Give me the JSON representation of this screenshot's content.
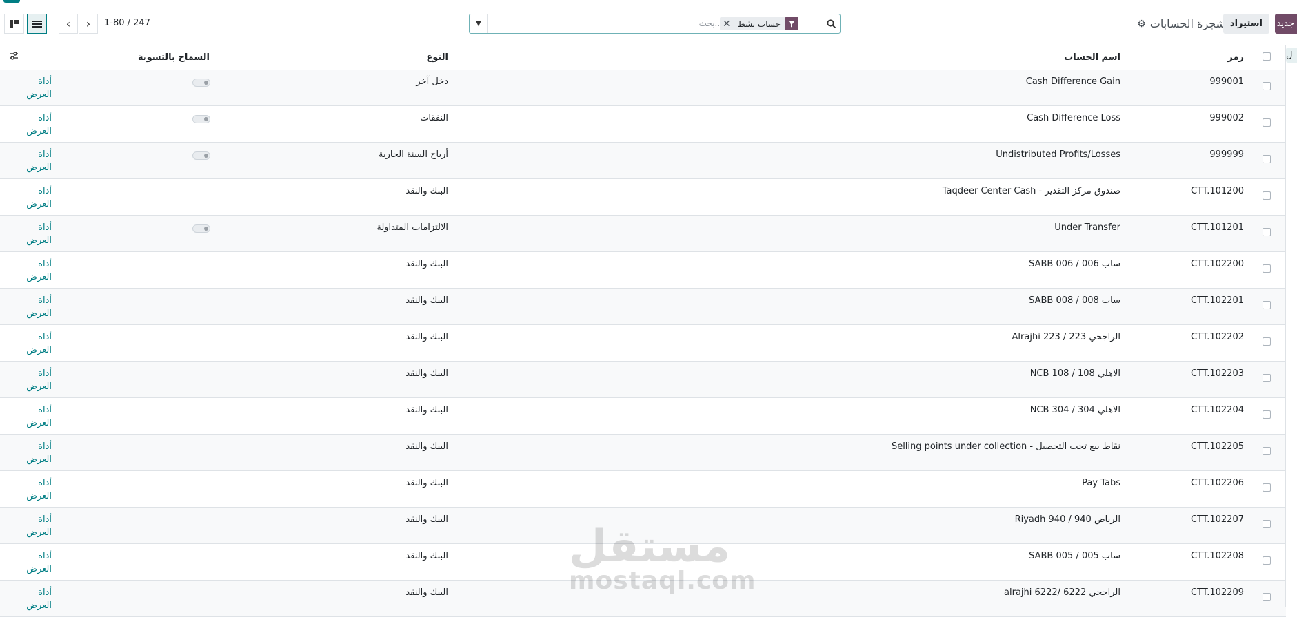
{
  "header": {
    "new_label": "جديد",
    "import_label": "استيراد",
    "title": "شجرة الحسابات",
    "search": {
      "placeholder": "بحث...",
      "facet": "حساب نشط"
    },
    "pager": "1-80 / 247"
  },
  "columns": {
    "code": "رمز",
    "name": "اسم الحساب",
    "type": "النوع",
    "reconcile": "السماح بالتسوية"
  },
  "side_tab_label": "ل",
  "rows": [
    {
      "code": "999001",
      "name": "Cash Difference Gain",
      "type": "دخل آخر",
      "reconcile_toggle": true,
      "tool": "أداة العرض"
    },
    {
      "code": "999002",
      "name": "Cash Difference Loss",
      "type": "النفقات",
      "reconcile_toggle": true,
      "tool": "أداة العرض"
    },
    {
      "code": "999999",
      "name": "Undistributed Profits/Losses",
      "type": "أرباح السنة الجارية",
      "reconcile_toggle": true,
      "tool": "أداة العرض"
    },
    {
      "code": "CTT.101200",
      "name": "Taqdeer Center Cash - صندوق مركز التقدير",
      "type": "البنك والنقد",
      "reconcile_toggle": false,
      "tool": "أداة العرض"
    },
    {
      "code": "CTT.101201",
      "name": "Under Transfer",
      "type": "الالتزامات المتداولة",
      "reconcile_toggle": true,
      "tool": "أداة العرض"
    },
    {
      "code": "CTT.102200",
      "name": "SABB 006 / ساب 006",
      "type": "البنك والنقد",
      "reconcile_toggle": false,
      "tool": "أداة العرض"
    },
    {
      "code": "CTT.102201",
      "name": "SABB 008 / ساب 008",
      "type": "البنك والنقد",
      "reconcile_toggle": false,
      "tool": "أداة العرض"
    },
    {
      "code": "CTT.102202",
      "name": "Alrajhi 223 / الراجحي 223",
      "type": "البنك والنقد",
      "reconcile_toggle": false,
      "tool": "أداة العرض"
    },
    {
      "code": "CTT.102203",
      "name": "NCB 108 / الاهلي 108",
      "type": "البنك والنقد",
      "reconcile_toggle": false,
      "tool": "أداة العرض"
    },
    {
      "code": "CTT.102204",
      "name": "NCB 304 / الاهلي 304",
      "type": "البنك والنقد",
      "reconcile_toggle": false,
      "tool": "أداة العرض"
    },
    {
      "code": "CTT.102205",
      "name": "Selling points under collection - نقاط بيع تحت التحصيل",
      "type": "البنك والنقد",
      "reconcile_toggle": false,
      "tool": "أداة العرض"
    },
    {
      "code": "CTT.102206",
      "name": "Pay Tabs",
      "type": "البنك والنقد",
      "reconcile_toggle": false,
      "tool": "أداة العرض"
    },
    {
      "code": "CTT.102207",
      "name": "Riyadh 940 / الرياض 940",
      "type": "البنك والنقد",
      "reconcile_toggle": false,
      "tool": "أداة العرض"
    },
    {
      "code": "CTT.102208",
      "name": "SABB 005 / ساب 005",
      "type": "البنك والنقد",
      "reconcile_toggle": false,
      "tool": "أداة العرض"
    },
    {
      "code": "CTT.102209",
      "name": "alrajhi 6222/ الراجحي 6222",
      "type": "البنك والنقد",
      "reconcile_toggle": false,
      "tool": "أداة العرض"
    }
  ],
  "watermark": {
    "arabic": "مستقل",
    "latin": "mostaql.com"
  },
  "colors": {
    "brand": "#714b67",
    "accent": "#017e84",
    "border": "#dee2e6"
  }
}
